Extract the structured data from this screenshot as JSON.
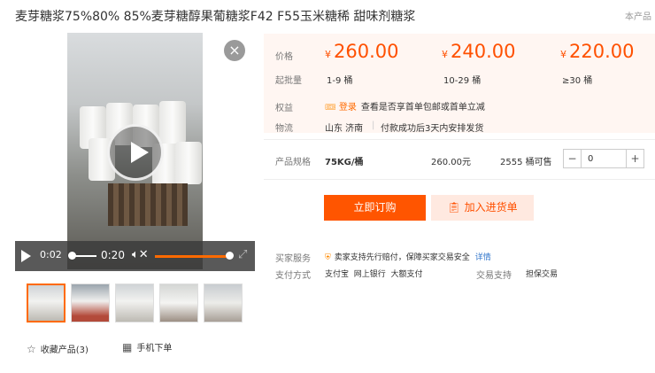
{
  "title": "麦芽糖浆75%80% 85%麦芽糖醇果葡糖浆F42 F55玉米糖稀 甜味剂糖浆",
  "shop_tag": "本产品",
  "video": {
    "current_time": "0:02",
    "duration": "0:20"
  },
  "thumbnails": [
    "thumb-1",
    "thumb-2",
    "thumb-3",
    "thumb-4",
    "thumb-5"
  ],
  "actions": {
    "favorite": "收藏产品(3)",
    "mobile_order": "手机下单"
  },
  "pricing": {
    "price_label": "价格",
    "moq_label": "起批量",
    "currency": "¥",
    "tiers": [
      {
        "price": "260.00",
        "range": "1-9 桶"
      },
      {
        "price": "240.00",
        "range": "10-29 桶"
      },
      {
        "price": "220.00",
        "range": "≥30 桶"
      }
    ]
  },
  "benefits": {
    "label": "权益",
    "login": "登录",
    "text": "查看是否享首单包邮或首单立减"
  },
  "logistics": {
    "label": "物流",
    "origin": "山东 济南",
    "text": "付款成功后3天内安排发货"
  },
  "spec": {
    "label": "产品规格",
    "name": "75KG/桶",
    "price": "260.00元",
    "stock": "2555 桶可售",
    "quantity": "0",
    "minus": "−",
    "plus": "+"
  },
  "buttons": {
    "buy": "立即订购",
    "cart": "加入进货单"
  },
  "service": {
    "label": "买家服务",
    "text": "卖家支持先行赔付，保障买家交易安全",
    "detail": "详情"
  },
  "payment": {
    "label": "支付方式",
    "methods": "支付宝  网上银行  大额支付",
    "trade_label": "交易支持",
    "trade_value": "担保交易"
  },
  "colors": {
    "accent": "#ff5000",
    "price_bg": "#fff6f2"
  }
}
